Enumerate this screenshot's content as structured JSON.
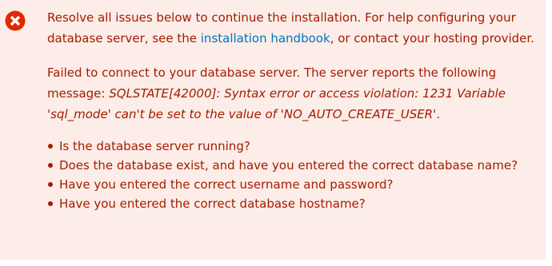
{
  "message": {
    "intro_before_link": "Resolve all issues below to continue the installation. For help configuring your database server, see the ",
    "link_text": "installation handbook",
    "intro_after_link": ", or contact your hosting provider.",
    "error_prefix": "Failed to connect to your database server. The server reports the following message: ",
    "error_detail": "SQLSTATE[42000]: Syntax error or access violation: 1231 Variable 'sql_mode' can't be set to the value of 'NO_AUTO_CREATE_USER'",
    "error_suffix": "."
  },
  "checklist": [
    "Is the database server running?",
    "Does the database exist, and have you entered the correct database name?",
    "Have you entered the correct username and password?",
    "Have you entered the correct database hostname?"
  ],
  "icon": "error-circle-x-icon",
  "colors": {
    "background": "#fcede8",
    "text": "#a51b00",
    "link": "#0074bd",
    "icon": "#e32700"
  }
}
